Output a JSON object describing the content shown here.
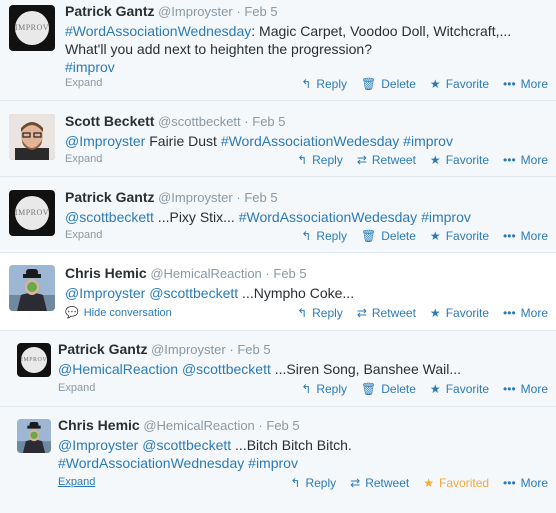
{
  "actions": {
    "reply": "Reply",
    "delete": "Delete",
    "retweet": "Retweet",
    "favorite": "Favorite",
    "favorited": "Favorited",
    "more": "More",
    "expand": "Expand",
    "hide_conversation": "Hide conversation"
  },
  "icons": {
    "reply": "reply-icon",
    "delete": "trash-icon",
    "retweet": "retweet-icon",
    "favorite": "star-icon",
    "more": "ellipsis-icon",
    "conversation": "speech-bubble-icon"
  },
  "colors": {
    "link": "#2b7bb9",
    "muted": "#8899a6",
    "favorited": "#f4a93a"
  },
  "avatars": {
    "improv_text": "IMPROV"
  },
  "tweets": [
    {
      "fullname": "Patrick Gantz",
      "username": "@Improyster",
      "sep": "·",
      "time": "Feb 5",
      "line1_tag": "#WordAssociationWednesday",
      "line1_rest": ": Magic Carpet, Voodoo Doll, Witchcraft,...",
      "line2": "What'll you add next to heighten the progression?",
      "line3_tag": "#improv"
    },
    {
      "fullname": "Scott Beckett",
      "username": "@scottbeckett",
      "sep": "·",
      "time": "Feb 5",
      "mention1": "@Improyster",
      "body": " Fairie Dust ",
      "tag1": "#WordAssociationWedesday",
      "space": " ",
      "tag2": "#improv"
    },
    {
      "fullname": "Patrick Gantz",
      "username": "@Improyster",
      "sep": "·",
      "time": "Feb 5",
      "mention1": "@scottbeckett",
      "body": " ...Pixy Stix... ",
      "tag1": "#WordAssociationWedesday",
      "space": " ",
      "tag2": "#improv"
    },
    {
      "fullname": "Chris Hemic",
      "username": "@HemicalReaction",
      "sep": "·",
      "time": "Feb 5",
      "mention1": "@Improyster",
      "space": " ",
      "mention2": "@scottbeckett",
      "body": " ...Nympho Coke..."
    },
    {
      "fullname": "Patrick Gantz",
      "username": "@Improyster",
      "sep": "·",
      "time": "Feb 5",
      "mention1": "@HemicalReaction",
      "space": " ",
      "mention2": "@scottbeckett",
      "body": " ...Siren Song, Banshee Wail..."
    },
    {
      "fullname": "Chris Hemic",
      "username": "@HemicalReaction",
      "sep": "·",
      "time": "Feb 5",
      "mention1": "@Improyster",
      "space": " ",
      "mention2": "@scottbeckett",
      "body": " ...Bitch Bitch Bitch.",
      "tag1": "#WordAssociationWednesday",
      "tag2": "#improv"
    }
  ]
}
